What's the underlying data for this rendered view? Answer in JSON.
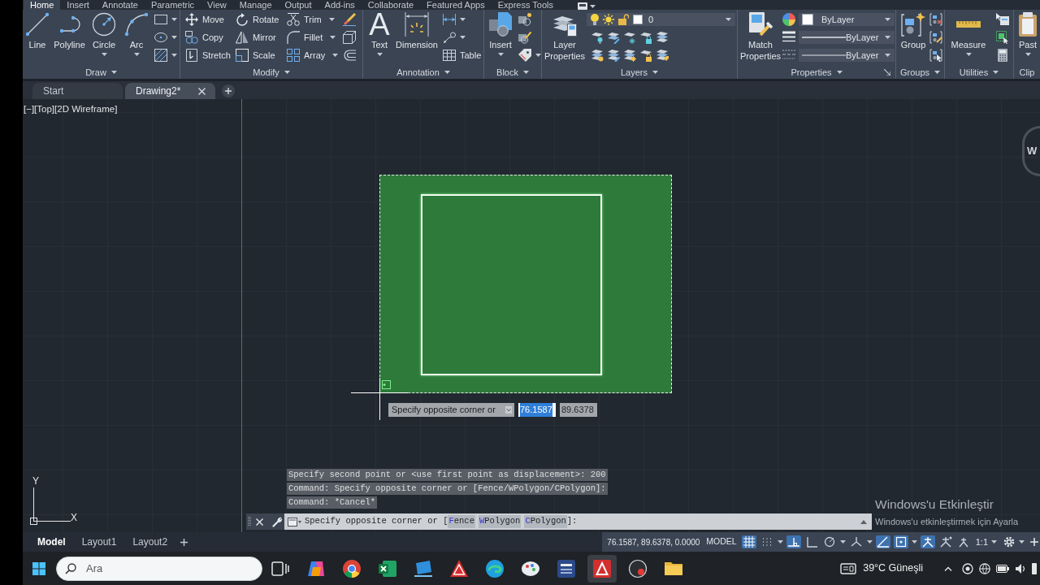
{
  "ribbon_tabs": [
    {
      "label": "Home",
      "selected": true
    },
    {
      "label": "Insert",
      "selected": false
    },
    {
      "label": "Annotate",
      "selected": false
    },
    {
      "label": "Parametric",
      "selected": false
    },
    {
      "label": "View",
      "selected": false
    },
    {
      "label": "Manage",
      "selected": false
    },
    {
      "label": "Output",
      "selected": false
    },
    {
      "label": "Add-ins",
      "selected": false
    },
    {
      "label": "Collaborate",
      "selected": false
    },
    {
      "label": "Featured Apps",
      "selected": false
    },
    {
      "label": "Express Tools",
      "selected": false
    }
  ],
  "panels": [
    {
      "title": "Draw",
      "has_menu": true,
      "tools": [
        {
          "label": "Line",
          "has_menu": false
        },
        {
          "label": "Polyline",
          "has_menu": false
        },
        {
          "label": "Circle",
          "has_menu": true
        },
        {
          "label": "Arc",
          "has_menu": true
        }
      ]
    },
    {
      "title": "Modify",
      "has_menu": true,
      "tools": [
        {
          "label": "Move",
          "has_menu": false
        },
        {
          "label": "Rotate",
          "has_menu": false
        },
        {
          "label": "Trim",
          "has_menu": true
        },
        {
          "label": "Copy",
          "has_menu": false
        },
        {
          "label": "Mirror",
          "has_menu": false
        },
        {
          "label": "Fillet",
          "has_menu": true
        },
        {
          "label": "Stretch",
          "has_menu": false
        },
        {
          "label": "Scale",
          "has_menu": false
        },
        {
          "label": "Array",
          "has_menu": true
        }
      ]
    },
    {
      "title": "Annotation",
      "has_menu": true,
      "tools": [
        {
          "kind": "large",
          "glyph": "A",
          "label": "Text",
          "has_menu": true
        },
        {
          "kind": "large",
          "label": "Dimension",
          "has_menu": false
        },
        {
          "kind": "small",
          "label": "Table",
          "has_menu": false
        }
      ]
    },
    {
      "title": "Block",
      "has_menu": true,
      "tools": [
        {
          "label": "Insert",
          "has_menu": true
        }
      ]
    },
    {
      "title": "Layers",
      "has_menu": true,
      "tools": [
        {
          "label": "Layer Properties",
          "has_menu": false
        }
      ],
      "layer": {
        "value": "0"
      }
    },
    {
      "title": "Properties",
      "has_menu": true,
      "tools": [
        {
          "label": "Match Properties",
          "has_menu": false
        }
      ],
      "dropdowns": [
        {
          "kind": "color",
          "value": "ByLayer"
        },
        {
          "kind": "lineweight",
          "value": "ByLayer"
        },
        {
          "kind": "linetype",
          "value": "ByLayer"
        }
      ]
    },
    {
      "title": "Groups",
      "has_menu": true,
      "tools": [
        {
          "label": "Group",
          "has_menu": false
        }
      ]
    },
    {
      "title": "Utilities",
      "has_menu": true,
      "tools": [
        {
          "label": "Measure",
          "has_menu": true
        }
      ]
    },
    {
      "title": "Clip",
      "has_menu": false,
      "tools": [
        {
          "label": "Past",
          "has_menu": true
        }
      ]
    }
  ],
  "document_tabs": [
    {
      "label": "Start",
      "selected": false,
      "closable": false
    },
    {
      "label": "Drawing2*",
      "selected": true,
      "closable": true
    }
  ],
  "viewport_label": "[−][Top][2D Wireframe]",
  "compass_letter": "W",
  "dynamic_input": {
    "prompt": "Specify opposite corner or",
    "fields": [
      {
        "value": "76.1587",
        "selected": true
      },
      {
        "value": "89.6378",
        "selected": false
      }
    ]
  },
  "ucs": {
    "y_label": "Y",
    "x_label": "X"
  },
  "command_history": [
    "Specify second point or <use first point as displacement>: 200",
    "Command: Specify opposite corner or [Fence/WPolygon/CPolygon]:",
    "Command: *Cancel*"
  ],
  "command_line": {
    "prompt": "Specify opposite corner or [",
    "options": [
      {
        "key": "F",
        "rest": "ence"
      },
      {
        "key": "W",
        "rest": "Polygon"
      },
      {
        "key": "C",
        "rest": "Polygon"
      }
    ],
    "suffix": "]:"
  },
  "activation_notice": {
    "title": "Windows'u Etkinleştir",
    "subtitle": "Windows'u etkinleştirmek için Ayarla"
  },
  "layout_tabs": [
    {
      "label": "Model",
      "selected": true
    },
    {
      "label": "Layout1",
      "selected": false
    },
    {
      "label": "Layout2",
      "selected": false
    }
  ],
  "status_bar": {
    "coordinates": "76.1587, 89.6378, 0.0000",
    "space": "MODEL",
    "toggles": [
      {
        "on": true
      },
      {
        "on": false
      },
      {
        "on": true
      },
      {
        "on": false
      },
      {
        "on": false
      },
      {
        "on": false
      },
      {
        "on": true
      },
      {
        "on": true
      },
      {
        "on": true
      },
      {
        "on": false
      },
      {
        "on": false
      }
    ],
    "scale": "1:1"
  },
  "taskbar": {
    "search": {
      "placeholder": "Ara"
    },
    "apps": [
      {
        "active": false
      },
      {
        "active": false
      },
      {
        "active": false
      },
      {
        "active": false
      },
      {
        "active": false
      },
      {
        "active": false
      },
      {
        "active": false
      },
      {
        "active": false
      },
      {
        "active": false
      },
      {
        "active": true
      },
      {
        "active": false
      },
      {
        "active": false
      }
    ],
    "weather": "39°C Güneşli"
  }
}
